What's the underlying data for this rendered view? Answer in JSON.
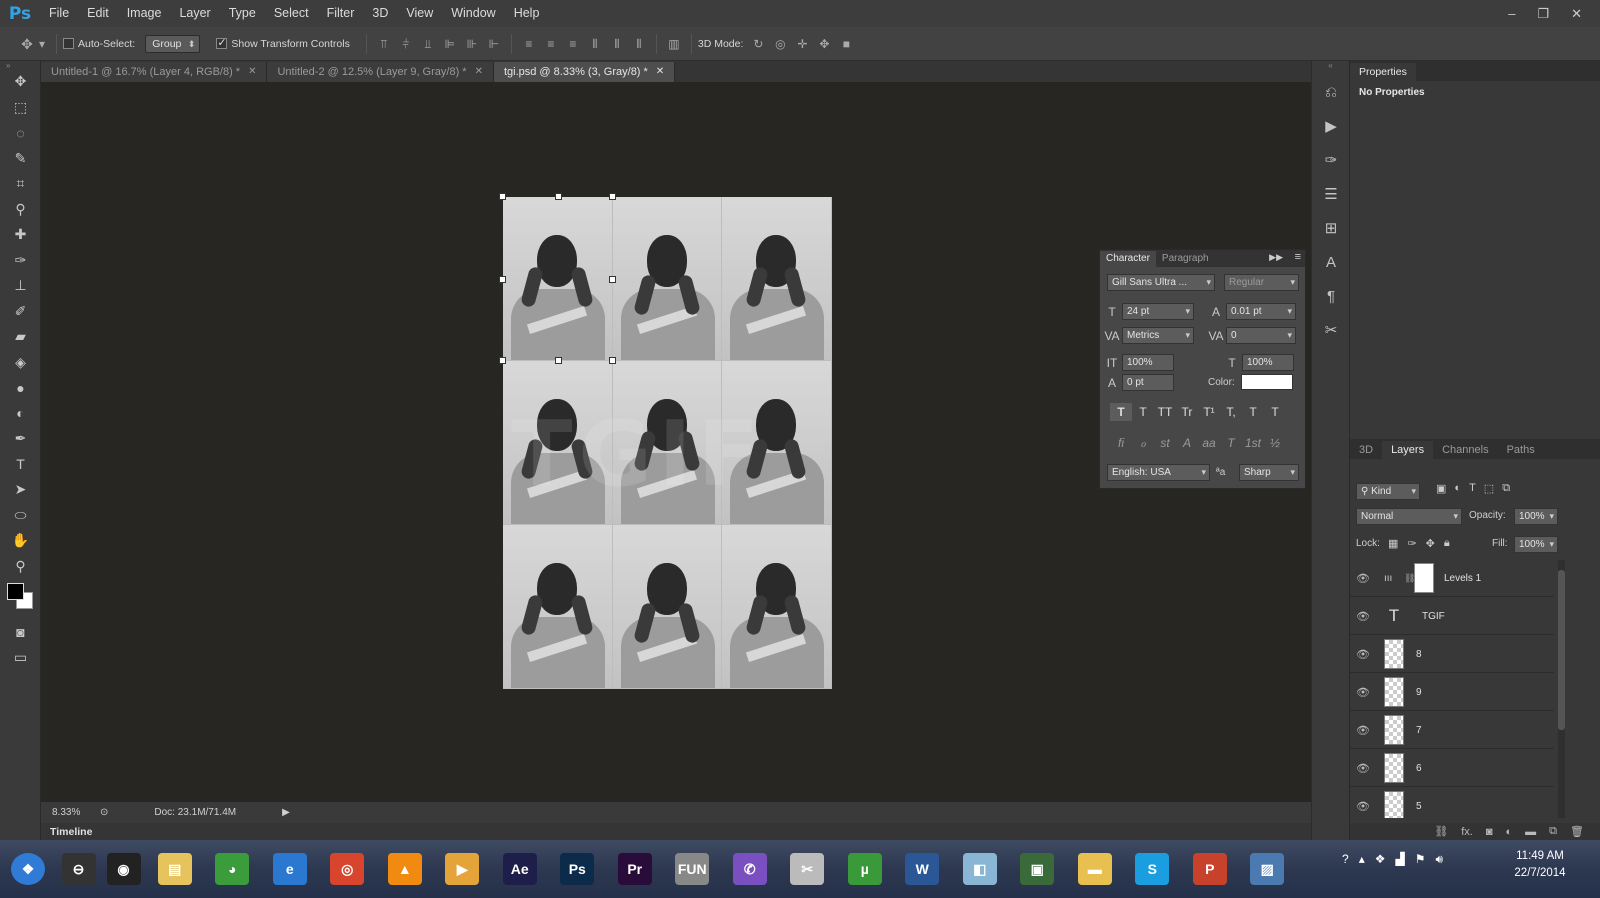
{
  "app": {
    "logo": "Ps"
  },
  "menu": [
    "File",
    "Edit",
    "Image",
    "Layer",
    "Type",
    "Select",
    "Filter",
    "3D",
    "View",
    "Window",
    "Help"
  ],
  "window_controls": [
    "–",
    "❐",
    "✕"
  ],
  "options": {
    "auto_select_label": "Auto-Select:",
    "auto_select_value": "Group",
    "show_transform_label": "Show Transform Controls",
    "mode3d_label": "3D Mode:",
    "workspace": "3D"
  },
  "tabs": [
    {
      "label": "Untitled-1 @ 16.7% (Layer 4, RGB/8) *"
    },
    {
      "label": "Untitled-2 @ 12.5% (Layer 9, Gray/8) *"
    },
    {
      "label": "tgi.psd @ 8.33% (3, Gray/8) *"
    }
  ],
  "status": {
    "zoom": "8.33%",
    "doc": "Doc: 23.1M/71.4M"
  },
  "timeline_label": "Timeline",
  "properties": {
    "tab": "Properties",
    "message": "No Properties"
  },
  "character": {
    "tab_character": "Character",
    "tab_paragraph": "Paragraph",
    "font_family": "Gill Sans Ultra ...",
    "font_style": "Regular",
    "size": "24 pt",
    "leading": "0.01 pt",
    "kerning": "Metrics",
    "tracking": "0",
    "vscale": "100%",
    "hscale": "100%",
    "baseline": "0 pt",
    "color_label": "Color:",
    "color_value": "#ffffff",
    "language": "English: USA",
    "aa_label": "ªa",
    "antialias": "Sharp",
    "type_buttons": [
      "T",
      "T",
      "TT",
      "Tr",
      "T¹",
      "T,",
      "T",
      "T"
    ],
    "opentype_buttons": [
      "fi",
      "ℴ",
      "st",
      "A",
      "aa",
      "T",
      "1st",
      "½"
    ]
  },
  "layers_panel": {
    "tabs": [
      "3D",
      "Layers",
      "Channels",
      "Paths"
    ],
    "filter": "Kind",
    "blend": "Normal",
    "opacity_label": "Opacity:",
    "opacity": "100%",
    "lock_label": "Lock:",
    "fill_label": "Fill:",
    "fill": "100%",
    "layers": [
      {
        "name": "Levels 1",
        "kind": "adjustment"
      },
      {
        "name": "TGIF",
        "kind": "text"
      },
      {
        "name": "8",
        "kind": "pixel"
      },
      {
        "name": "9",
        "kind": "pixel"
      },
      {
        "name": "7",
        "kind": "pixel"
      },
      {
        "name": "6",
        "kind": "pixel"
      },
      {
        "name": "5",
        "kind": "pixel"
      }
    ],
    "footer_icons": [
      "link-icon",
      "fx-icon",
      "mask-icon",
      "adjustment-icon",
      "folder-icon",
      "new-layer-icon",
      "trash-icon"
    ],
    "footer_fx": "fx."
  },
  "taskbar": {
    "time": "11:49 AM",
    "date": "22/7/2014",
    "apps": [
      {
        "name": "start",
        "glyph": "❖",
        "color": "#2f7bd6"
      },
      {
        "name": "sync",
        "glyph": "⊖",
        "color": "#333"
      },
      {
        "name": "camera",
        "glyph": "◉",
        "color": "#222"
      },
      {
        "name": "explorer",
        "glyph": "▤",
        "color": "#e6c35c"
      },
      {
        "name": "network",
        "glyph": "◕",
        "color": "#3a9c3a"
      },
      {
        "name": "ie",
        "glyph": "e",
        "color": "#2a78d0"
      },
      {
        "name": "chrome",
        "glyph": "◎",
        "color": "#d8452f"
      },
      {
        "name": "vlc",
        "glyph": "▲",
        "color": "#f08a10"
      },
      {
        "name": "media",
        "glyph": "▶",
        "color": "#e4a43a"
      },
      {
        "name": "aftereffects",
        "glyph": "Ae",
        "color": "#1e1e4a"
      },
      {
        "name": "photoshop",
        "glyph": "Ps",
        "color": "#0c2a4a"
      },
      {
        "name": "premiere",
        "glyph": "Pr",
        "color": "#2a0c3a"
      },
      {
        "name": "fun",
        "glyph": "FUN",
        "color": "#888"
      },
      {
        "name": "viber",
        "glyph": "✆",
        "color": "#7a4fbf"
      },
      {
        "name": "tool",
        "glyph": "✂",
        "color": "#bbb"
      },
      {
        "name": "utorrent",
        "glyph": "µ",
        "color": "#3a9a3a"
      },
      {
        "name": "word",
        "glyph": "W",
        "color": "#2b5797"
      },
      {
        "name": "notes",
        "glyph": "◧",
        "color": "#8ab6d6"
      },
      {
        "name": "monitor",
        "glyph": "▣",
        "color": "#3a6a3a"
      },
      {
        "name": "folder",
        "glyph": "▬",
        "color": "#e8c050"
      },
      {
        "name": "skype",
        "glyph": "S",
        "color": "#1a9ee0"
      },
      {
        "name": "powerpoint",
        "glyph": "P",
        "color": "#c8412a"
      },
      {
        "name": "photo-viewer",
        "glyph": "▨",
        "color": "#4a7ab0"
      }
    ]
  }
}
